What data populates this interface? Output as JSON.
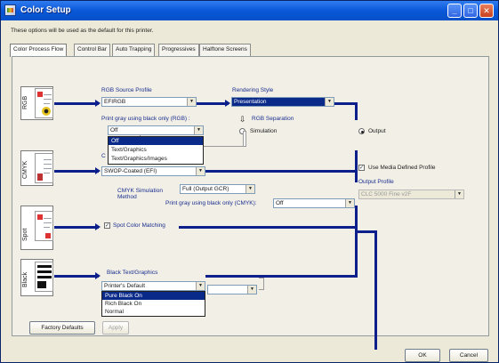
{
  "window": {
    "title": "Color Setup"
  },
  "info_text": "These options will be used as the default for this printer.",
  "tabs": [
    {
      "label": "Color Process Flow",
      "active": true
    },
    {
      "label": "Control Bar"
    },
    {
      "label": "Auto Trapping"
    },
    {
      "label": "Progressives"
    },
    {
      "label": "Halftone Screens"
    }
  ],
  "rgb": {
    "side_label": "RGB",
    "source_profile_label": "RGB Source Profile",
    "source_profile_value": "EFIRGB",
    "rendering_style_label": "Rendering Style",
    "rendering_style_value": "Presentation",
    "print_gray_label": "Print gray using black only (RGB) :",
    "print_gray_value": "Off",
    "print_gray_options": [
      "Off",
      "Text/Graphics",
      "Text/Graphics/Images"
    ],
    "separation_label": "RGB Separation",
    "simulation_label": "Simulation",
    "output_label": "Output"
  },
  "cmyk": {
    "side_label": "CMYK",
    "partial_label": "C",
    "source_value": "SWOP-Coated (EFI)",
    "simulation_method_label": "CMYK Simulation Method",
    "simulation_method_value": "Full (Output GCR)",
    "print_gray_label": "Print gray using black only (CMYK):",
    "print_gray_value": "Off"
  },
  "output_panel": {
    "use_media_label": "Use Media Defined Profile",
    "output_profile_label": "Output Profile",
    "output_profile_value": "CLC 5000 Fine v2F"
  },
  "spot": {
    "side_label": "Spot",
    "spot_matching_label": "Spot Color Matching"
  },
  "black": {
    "side_label": "Black",
    "text_graphics_label": "Black Text/Graphics",
    "text_graphics_value": "Printer's Default",
    "options": [
      "Pure Black On",
      "Rich Black On",
      "Normal"
    ]
  },
  "buttons": {
    "factory_defaults": "Factory Defaults",
    "apply": "Apply",
    "ok": "OK",
    "cancel": "Cancel"
  }
}
